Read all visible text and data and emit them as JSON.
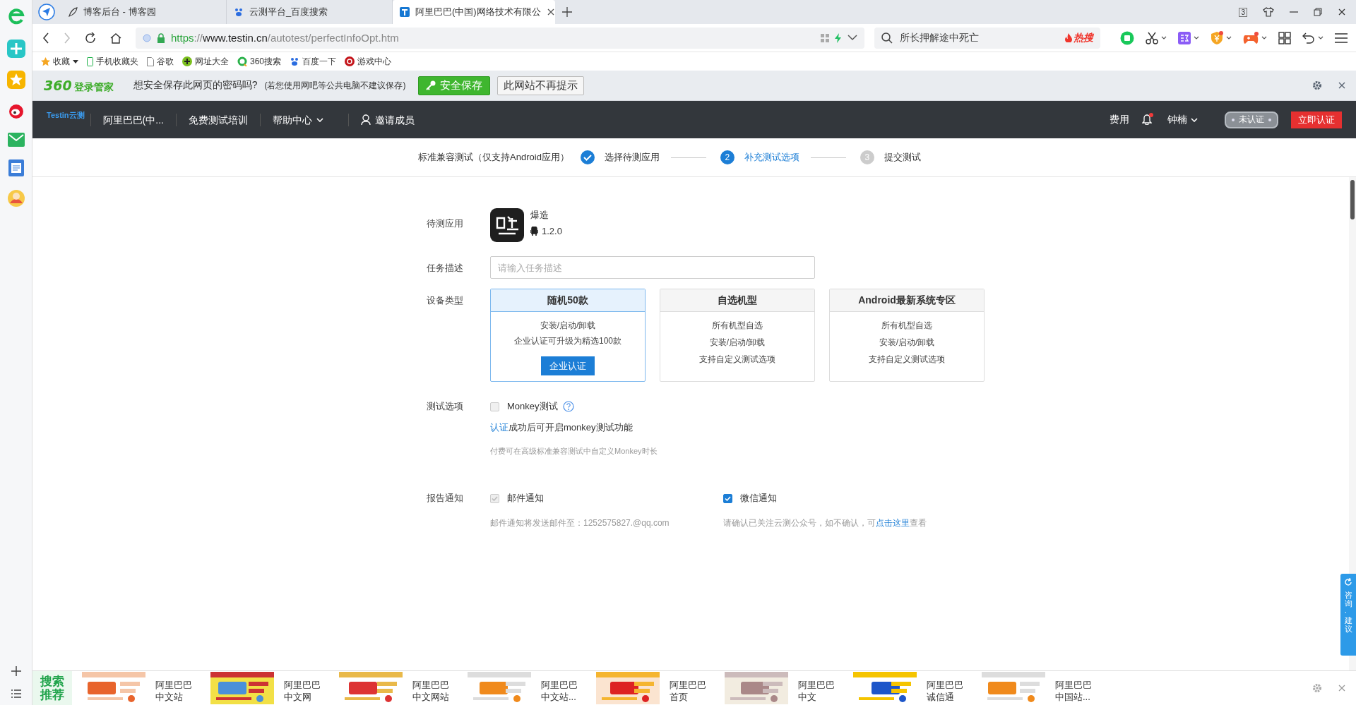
{
  "browser": {
    "tabs": [
      {
        "title": "博客后台 - 博客园",
        "selected": false
      },
      {
        "title": "云测平台_百度搜索",
        "selected": false
      },
      {
        "title": "阿里巴巴(中国)网络技术有限公",
        "selected": true
      }
    ],
    "tab_count": "3",
    "address": "https://www.testin.cn/autotest/perfectInfoOpt.htm",
    "search": {
      "value": "所长押解途中死亡",
      "hot": "热搜"
    },
    "bookmarks": [
      "收藏",
      "手机收藏夹",
      "谷歌",
      "网址大全",
      "360搜索",
      "百度一下",
      "游戏中心"
    ]
  },
  "password_bar": {
    "brand": "360",
    "brand_suffix": "登录管家",
    "question": "想安全保存此网页的密码吗?",
    "note": "(若您使用网吧等公共电脑不建议保存)",
    "save": "安全保存",
    "never": "此网站不再提示"
  },
  "site_nav": {
    "logo": "Testin云测",
    "items": [
      "阿里巴巴(中...",
      "免费测试培训",
      "帮助中心",
      "邀请成员"
    ],
    "fee": "费用",
    "user": "钟楠",
    "status": "未认证",
    "verify": "立即认证"
  },
  "steps": {
    "title": "标准兼容测试（仅支持Android应用）",
    "items": [
      {
        "label": "选择待测应用",
        "completed": true,
        "selected": false
      },
      {
        "number": "2",
        "label": "补充测试选项",
        "completed": false,
        "selected": true
      },
      {
        "number": "3",
        "label": "提交测试",
        "completed": false,
        "selected": false
      }
    ]
  },
  "form": {
    "app": {
      "label": "待测应用",
      "name": "爆造",
      "version": "1.2.0"
    },
    "task": {
      "label": "任务描述",
      "placeholder": "请输入任务描述"
    },
    "device": {
      "label": "设备类型",
      "options": [
        {
          "title": "随机50款",
          "lines": [
            "安装/启动/卸载",
            "企业认证可升级为精选100款"
          ],
          "button": "企业认证",
          "selected": true
        },
        {
          "title": "自选机型",
          "lines": [
            "所有机型自选",
            "安装/启动/卸载",
            "支持自定义测试选项"
          ],
          "selected": false
        },
        {
          "title": "Android最新系统专区",
          "lines": [
            "所有机型自选",
            "安装/启动/卸载",
            "支持自定义测试选项"
          ],
          "selected": false
        }
      ]
    },
    "test_options": {
      "label": "测试选项",
      "monkey": {
        "label": "Monkey测试",
        "checked": false,
        "disabled": true
      },
      "note_link": "认证",
      "note": "成功后可开启monkey测试功能",
      "hint": "付费可在高级标准兼容测试中自定义Monkey时长"
    },
    "report": {
      "label": "报告通知",
      "email": {
        "label": "邮件通知",
        "checked": true,
        "disabled": true
      },
      "email_note": "邮件通知将发送邮件至：1252575827.@qq.com",
      "wechat": {
        "label": "微信通知",
        "checked": true,
        "disabled": false
      },
      "wechat_note": "请确认已关注云测公众号，如不确认，可",
      "wechat_link": "点击这里",
      "wechat_note_end": "查看"
    }
  },
  "feedback": "咨询·建议",
  "recommend": {
    "label": "搜索推荐",
    "items": [
      {
        "lines": [
          "阿里巴巴",
          "中文站"
        ]
      },
      {
        "lines": [
          "阿里巴巴",
          "中文网"
        ]
      },
      {
        "lines": [
          "阿里巴巴",
          "中文网站"
        ]
      },
      {
        "lines": [
          "阿里巴巴",
          "中文站..."
        ]
      },
      {
        "lines": [
          "阿里巴巴",
          "首页"
        ]
      },
      {
        "lines": [
          "阿里巴巴",
          "中文"
        ]
      },
      {
        "lines": [
          "阿里巴巴",
          "诚信通"
        ]
      },
      {
        "lines": [
          "阿里巴巴",
          "中国站..."
        ]
      }
    ]
  }
}
